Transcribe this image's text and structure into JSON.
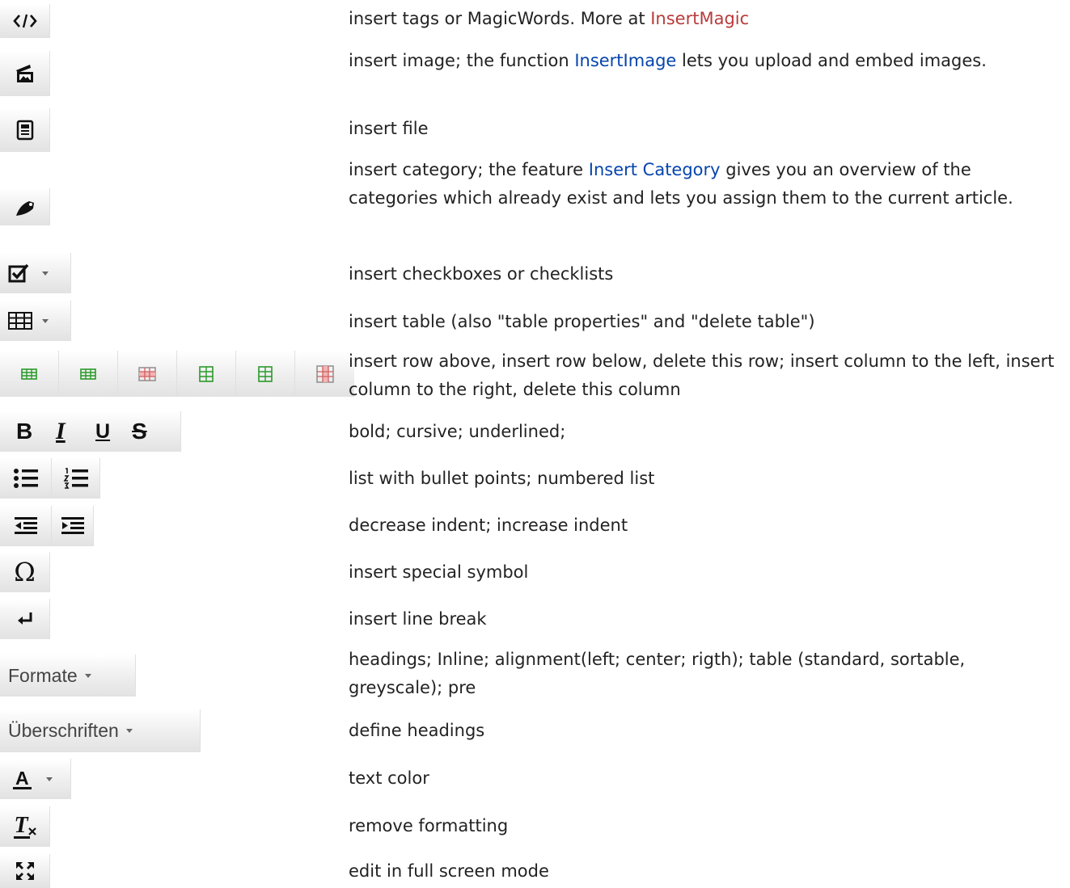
{
  "rows": [
    {
      "text_a": "insert tags or MagicWords. More at ",
      "link": "InsertMagic",
      "text_b": "",
      "icon": "code-tags-icon"
    },
    {
      "text_a": "insert image; the function ",
      "link": "InsertImage",
      "text_b": " lets you upload and embed images.",
      "icon": "insert-image-icon"
    },
    {
      "text_a": "insert file",
      "icon": "insert-file-icon"
    },
    {
      "text_a": "insert category; the feature ",
      "link": "Insert Category",
      "text_b": " gives you an overview of the categories which already exist and lets you assign them to the current article.",
      "icon": "tag-icon"
    },
    {
      "text_a": "insert checkboxes or checklists",
      "icon": "checkbox-icon"
    },
    {
      "text_a": "insert table (also \"table properties\" and \"delete table\")",
      "icon": "table-icon"
    },
    {
      "text_a": "insert row above, insert row below, delete this row; insert column to the left, insert column to the right, delete this column",
      "icons": [
        "insert-row-above-icon",
        "insert-row-below-icon",
        "delete-row-icon",
        "insert-column-left-icon",
        "insert-column-right-icon",
        "delete-column-icon"
      ]
    },
    {
      "text_a": "bold; cursive; underlined;",
      "icons": [
        "bold-icon",
        "italic-icon",
        "underline-icon",
        "strikethrough-icon"
      ],
      "glyphs": [
        "B",
        "I",
        "U",
        "S"
      ]
    },
    {
      "text_a": "list with bullet points; numbered list",
      "icons": [
        "bullet-list-icon",
        "numbered-list-icon"
      ]
    },
    {
      "text_a": "decrease indent; increase indent",
      "icons": [
        "decrease-indent-icon",
        "increase-indent-icon"
      ]
    },
    {
      "text_a": "insert special symbol",
      "icon": "omega-icon",
      "glyph": "Ω"
    },
    {
      "text_a": "insert line break",
      "icon": "line-break-icon",
      "glyph": "↵"
    },
    {
      "text_a": "headings; Inline; alignment(left; center; rigth); table (standard, sortable, greyscale); pre",
      "button_label": "Formate"
    },
    {
      "text_a": "define headings",
      "button_label": "Überschriften"
    },
    {
      "text_a": "text color",
      "icon": "text-color-icon",
      "glyph": "A"
    },
    {
      "text_a": "remove formatting",
      "icon": "remove-formatting-icon",
      "glyph": "T"
    },
    {
      "text_a": "edit in full screen mode",
      "icon": "fullscreen-icon"
    }
  ],
  "colors": {
    "link_missing": "#ba3b3b",
    "link": "#0645ad",
    "text": "#222222"
  }
}
